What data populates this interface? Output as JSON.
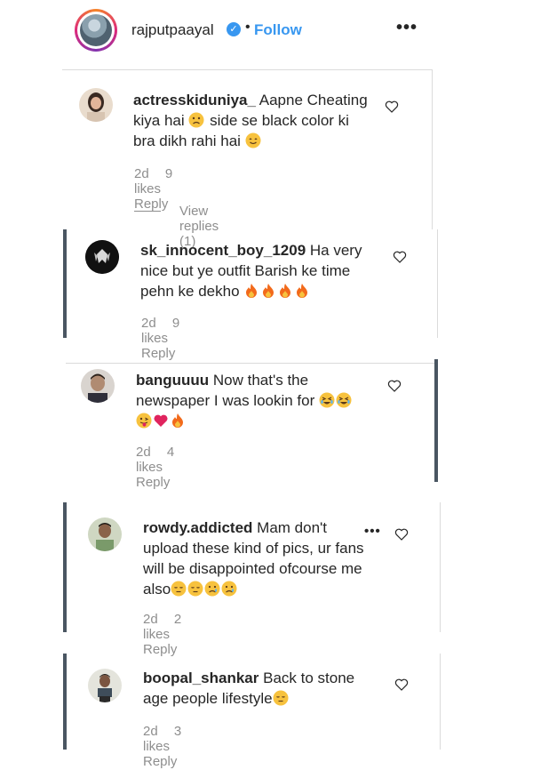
{
  "post": {
    "username": "rajputpaayal",
    "verified_mark": "✓",
    "separator": "•",
    "follow_label": "Follow",
    "more_label": "•••"
  },
  "comments": [
    {
      "username": "actresskiduniya_",
      "text1": "Aapne Cheating",
      "text2": "kiya hai",
      "text2b": "side se black color ki",
      "text3": "bra dikh rahi hai",
      "time": "2d",
      "likes": "9 likes",
      "reply": "Reply",
      "view_replies": "View replies (1)"
    },
    {
      "username": "sk_innocent_boy_1209",
      "text1": "Ha very",
      "text2": "nice but ye outfit Barish ke time",
      "text3": "pehn ke dekho",
      "time": "2d",
      "likes": "9 likes",
      "reply": "Reply"
    },
    {
      "username": "banguuuu",
      "text1": "Now that's the",
      "text2": "newspaper I was lookin for",
      "time": "2d",
      "likes": "4 likes",
      "reply": "Reply"
    },
    {
      "username": "rowdy.addicted",
      "text1": "Mam don't",
      "text2": "upload these kind of pics, ur fans",
      "text3": "will be disappointed ofcourse me",
      "text4": "also",
      "more": "•••",
      "time": "2d",
      "likes": "2 likes",
      "reply": "Reply"
    },
    {
      "username": "boopal_shankar",
      "text1": "Back to stone",
      "text2": "age people lifestyle",
      "time": "2d",
      "likes": "3 likes",
      "reply": "Reply"
    }
  ],
  "colors": {
    "link_blue": "#3897f0",
    "meta_grey": "#8e8e8e",
    "text": "#262626",
    "emoji_yellow": "#f7c23e",
    "fire": "#f26a1b",
    "heart_red": "#e0245e"
  }
}
